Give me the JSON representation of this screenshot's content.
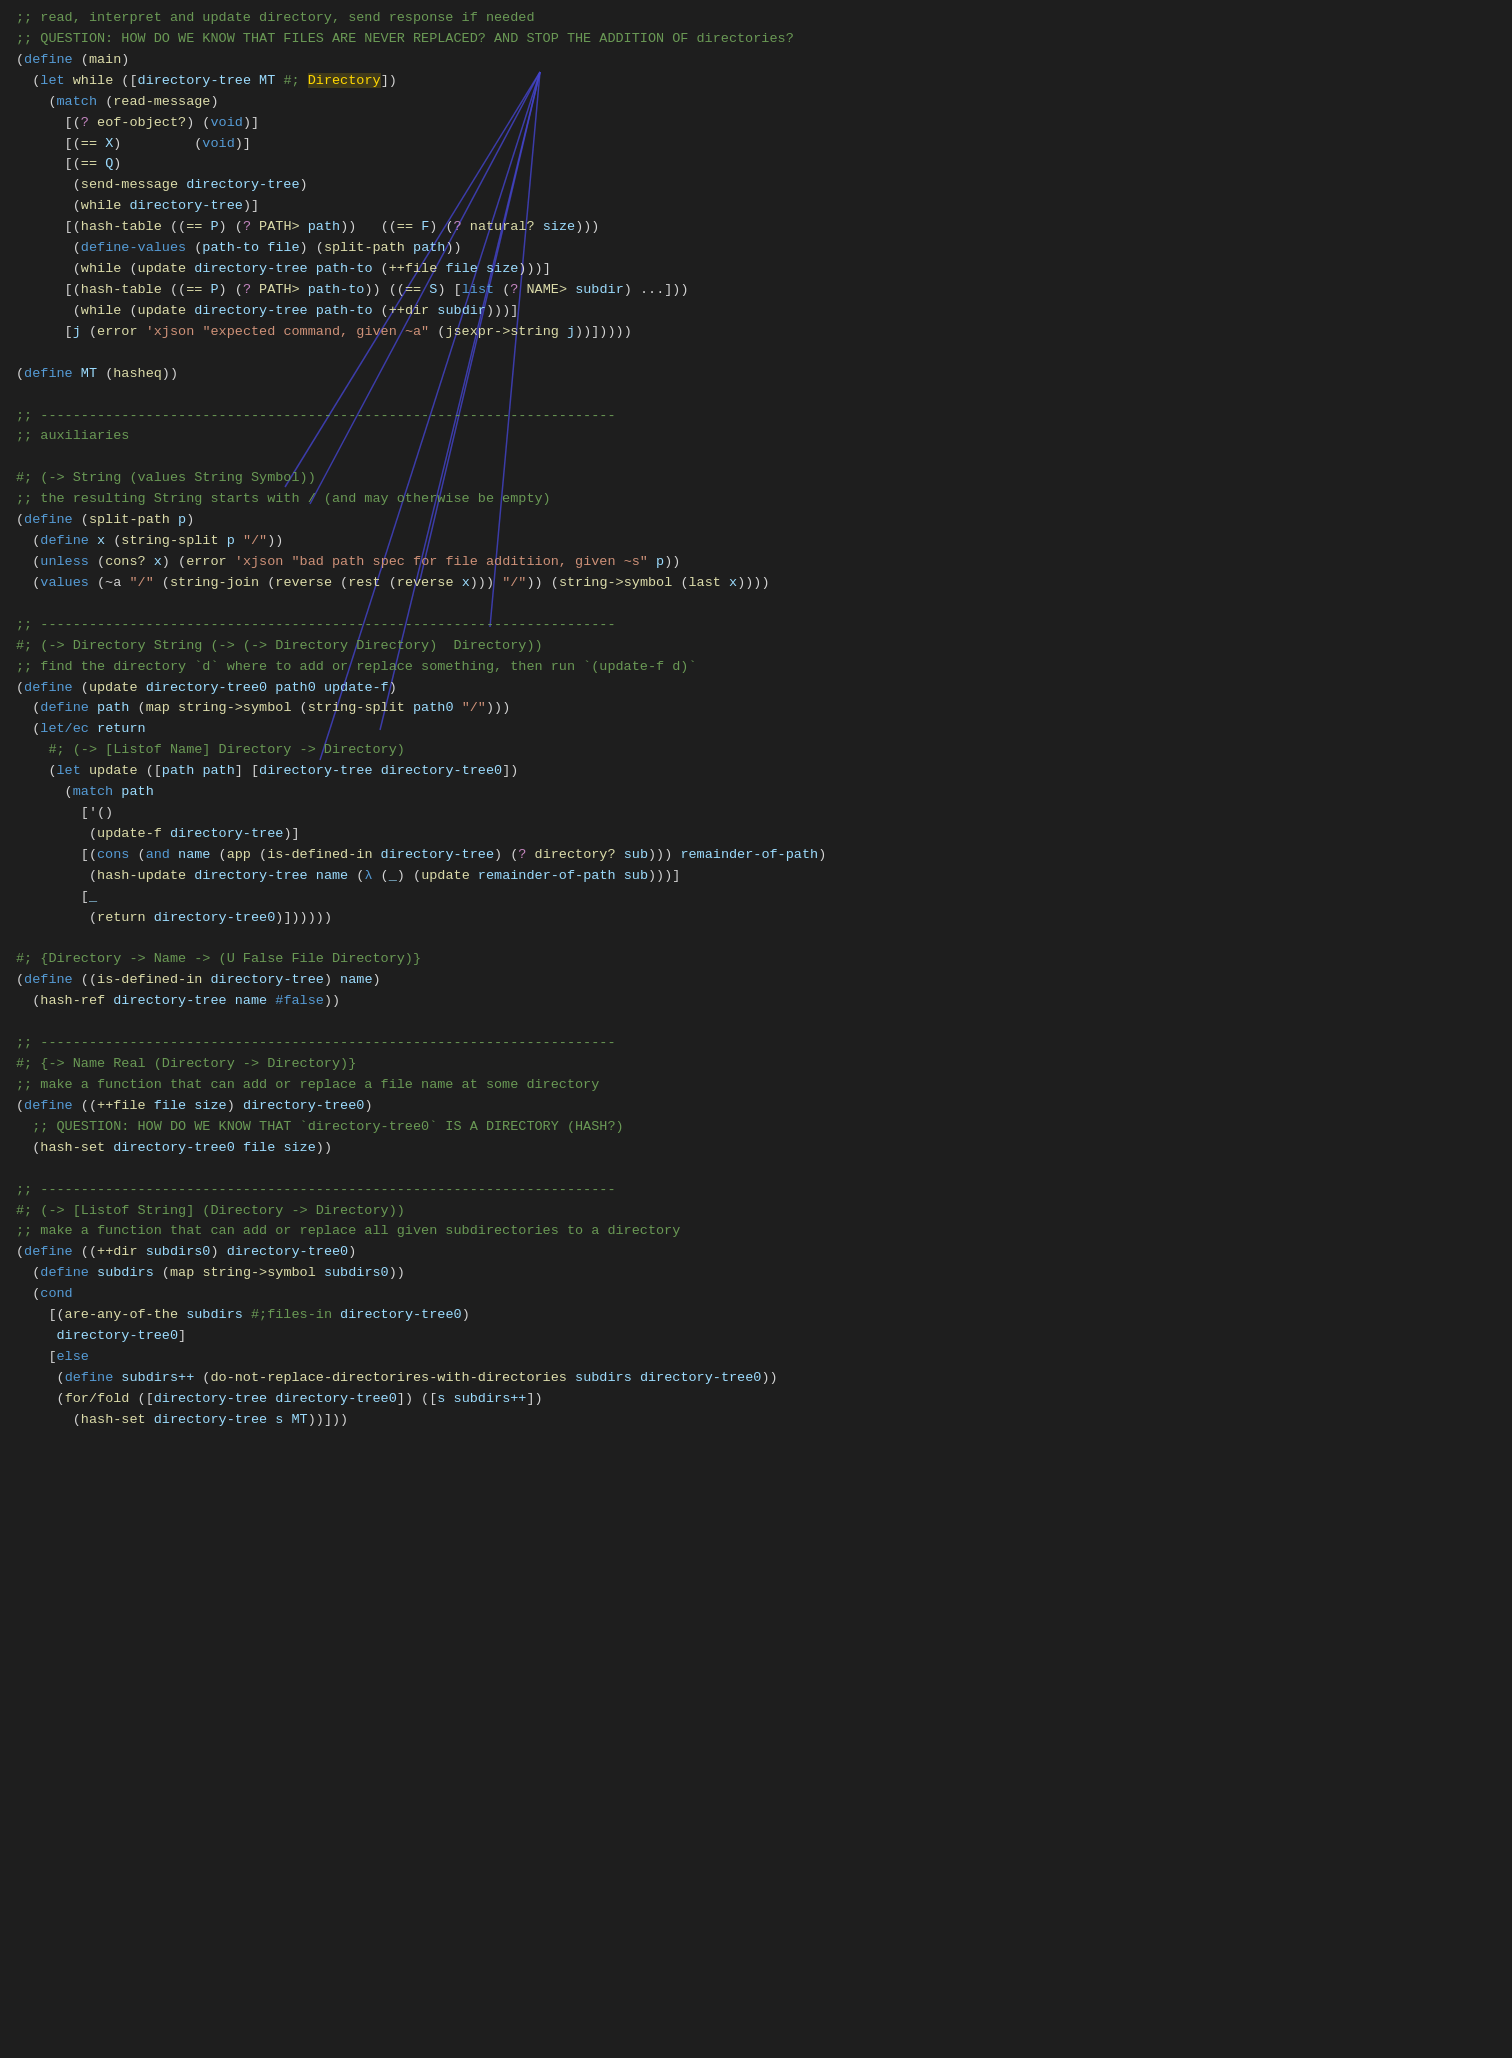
{
  "colors": {
    "background": "#1e1e1e",
    "comment": "#6a9955",
    "keyword": "#569cd6",
    "function": "#dcdcaa",
    "string": "#ce9178",
    "symbol": "#9cdcfe",
    "type": "#4ec9b0",
    "special": "#c586c0",
    "text": "#d4d4d4",
    "number": "#b5cea8",
    "line_arrow": "#4444cc"
  },
  "highlighted_word": "Directory",
  "lines": [
    ";; read, interpret and update directory, send response if needed",
    ";; QUESTION: HOW DO WE KNOW THAT FILES ARE NEVER REPLACED? AND STOP THE ADDITION OF directories?",
    "(define (main)",
    "  (let while ([directory-tree MT #; Directory])",
    "    (match (read-message)",
    "      [(? eof-object?) (void)]",
    "      [(== X)         (void)]",
    "      [(== Q)",
    "       (send-message directory-tree)",
    "       (while directory-tree)]",
    "      [(hash-table ((== P) (? PATH> path))   ((== F) (? natural? size)))",
    "       (define-values (path-to file) (split-path path))",
    "       (while (update directory-tree path-to (++file file size)))]",
    "      [(hash-table ((== P) (? PATH> path-to)) ((== S) [list (? NAME> subdir) ...]))",
    "       (while (update directory-tree path-to (++dir subdir)))]",
    "      [j (error 'xjson \"expected command, given ~a\" (jsexpr->string j))]))))",
    "",
    "(define MT (hasheq))",
    "",
    ";; -----------------------------------------------------------------------",
    ";; auxiliaries",
    "",
    "#; (-> String (values String Symbol))",
    ";; the resulting String starts with / (and may otherwise be empty)",
    "(define (split-path p)",
    "  (define x (string-split p \"/\"))",
    "  (unless (cons? x) (error 'xjson \"bad path spec for file additiion, given ~s\" p))",
    "  (values (~a \"/\" (string-join (reverse (rest (reverse x))) \"/\")) (string->symbol (last x))))",
    "",
    ";; -----------------------------------------------------------------------",
    "#; (-> Directory String (-> (-> Directory Directory)  Directory))",
    ";; find the directory `d` where to add or replace something, then run `(update-f d)`",
    "(define (update directory-tree0 path0 update-f)",
    "  (define path (map string->symbol (string-split path0 \"/\")))",
    "  (let/ec return",
    "    #; (-> [Listof Name] Directory -> Directory)",
    "    (let update ([path path] [directory-tree directory-tree0])",
    "      (match path",
    "        ['()",
    "         (update-f directory-tree)]",
    "        [(cons (and name (app (is-defined-in directory-tree) (? directory? sub))) remainder-of-path)",
    "         (hash-update directory-tree name (λ (_) (update remainder-of-path sub)))]",
    "        [_",
    "         (return directory-tree0)])))))",
    "",
    "#; {Directory -> Name -> (U False File Directory)}",
    "(define ((is-defined-in directory-tree) name)",
    "  (hash-ref directory-tree name #false))",
    "",
    ";; -----------------------------------------------------------------------",
    "#; {-> Name Real (Directory -> Directory)}",
    ";; make a function that can add or replace a file name at some directory",
    "(define ((++file file size) directory-tree0)",
    "  ;; QUESTION: HOW DO WE KNOW THAT `directory-tree0` IS A DIRECTORY (HASH?)",
    "  (hash-set directory-tree0 file size))",
    "",
    ";; -----------------------------------------------------------------------",
    "#; (-> [Listof String] (Directory -> Directory))",
    ";; make a function that can add or replace all given subdirectories to a directory",
    "(define ((++dir subdirs0) directory-tree0)",
    "  (define subdirs (map string->symbol subdirs0))",
    "  (cond",
    "    [(are-any-of-the subdirs #;files-in directory-tree0)",
    "     directory-tree0]",
    "    [else",
    "     (define subdirs++ (do-not-replace-directorires-with-directories subdirs directory-tree0))",
    "     (for/fold ([directory-tree directory-tree0]) ([s subdirs++])",
    "       (hash-set directory-tree s MT))]))"
  ]
}
